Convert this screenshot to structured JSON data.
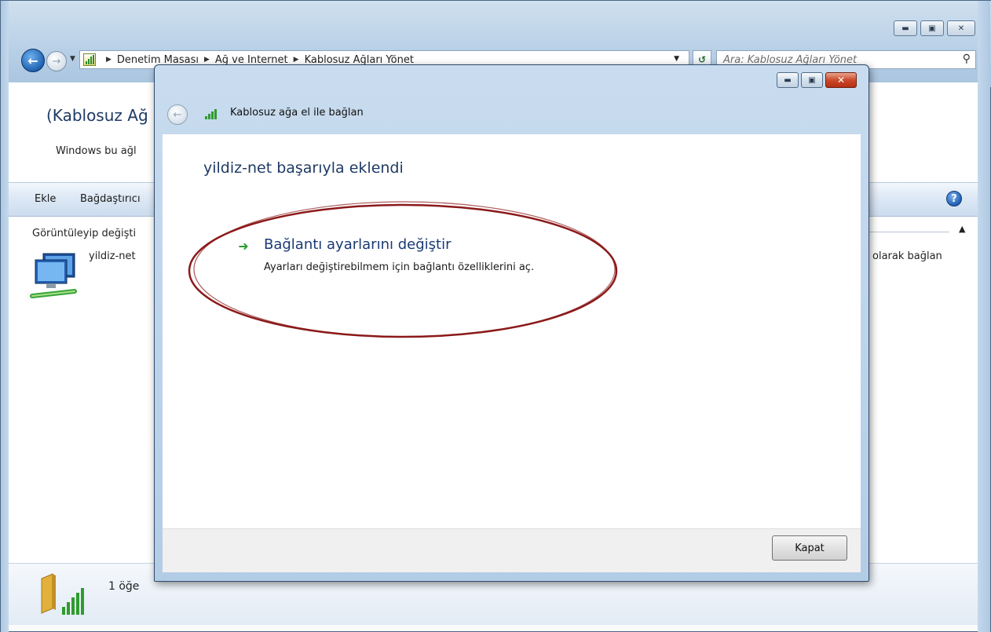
{
  "window": {
    "breadcrumbs": [
      "Denetim Masası",
      "Ağ ve Internet",
      "Kablosuz Ağları Yönet"
    ],
    "search_placeholder": "Ara: Kablosuz Ağları Yönet",
    "header_title": "(Kablosuz Ağ",
    "header_desc": "Windows bu ağl",
    "toolbar": {
      "add": "Ekle",
      "adapter": "Bağdaştırıcı"
    },
    "list_header": "Görüntüleyip değişti",
    "network_name": "yildiz-net",
    "right_text": "olarak bağlan",
    "status_count": "1 öğe"
  },
  "dialog": {
    "title": "Kablosuz ağa el ile bağlan",
    "heading": "yildiz-net başarıyla eklendi",
    "link_title": "Bağlantı ayarlarını değiştir",
    "link_desc": "Ayarları değiştirebilmem için bağlantı özelliklerini aç.",
    "close_label": "Kapat"
  },
  "colors": {
    "annotation": "#8b1a1a",
    "link": "#1a3a75",
    "heading": "#1f3a64"
  }
}
